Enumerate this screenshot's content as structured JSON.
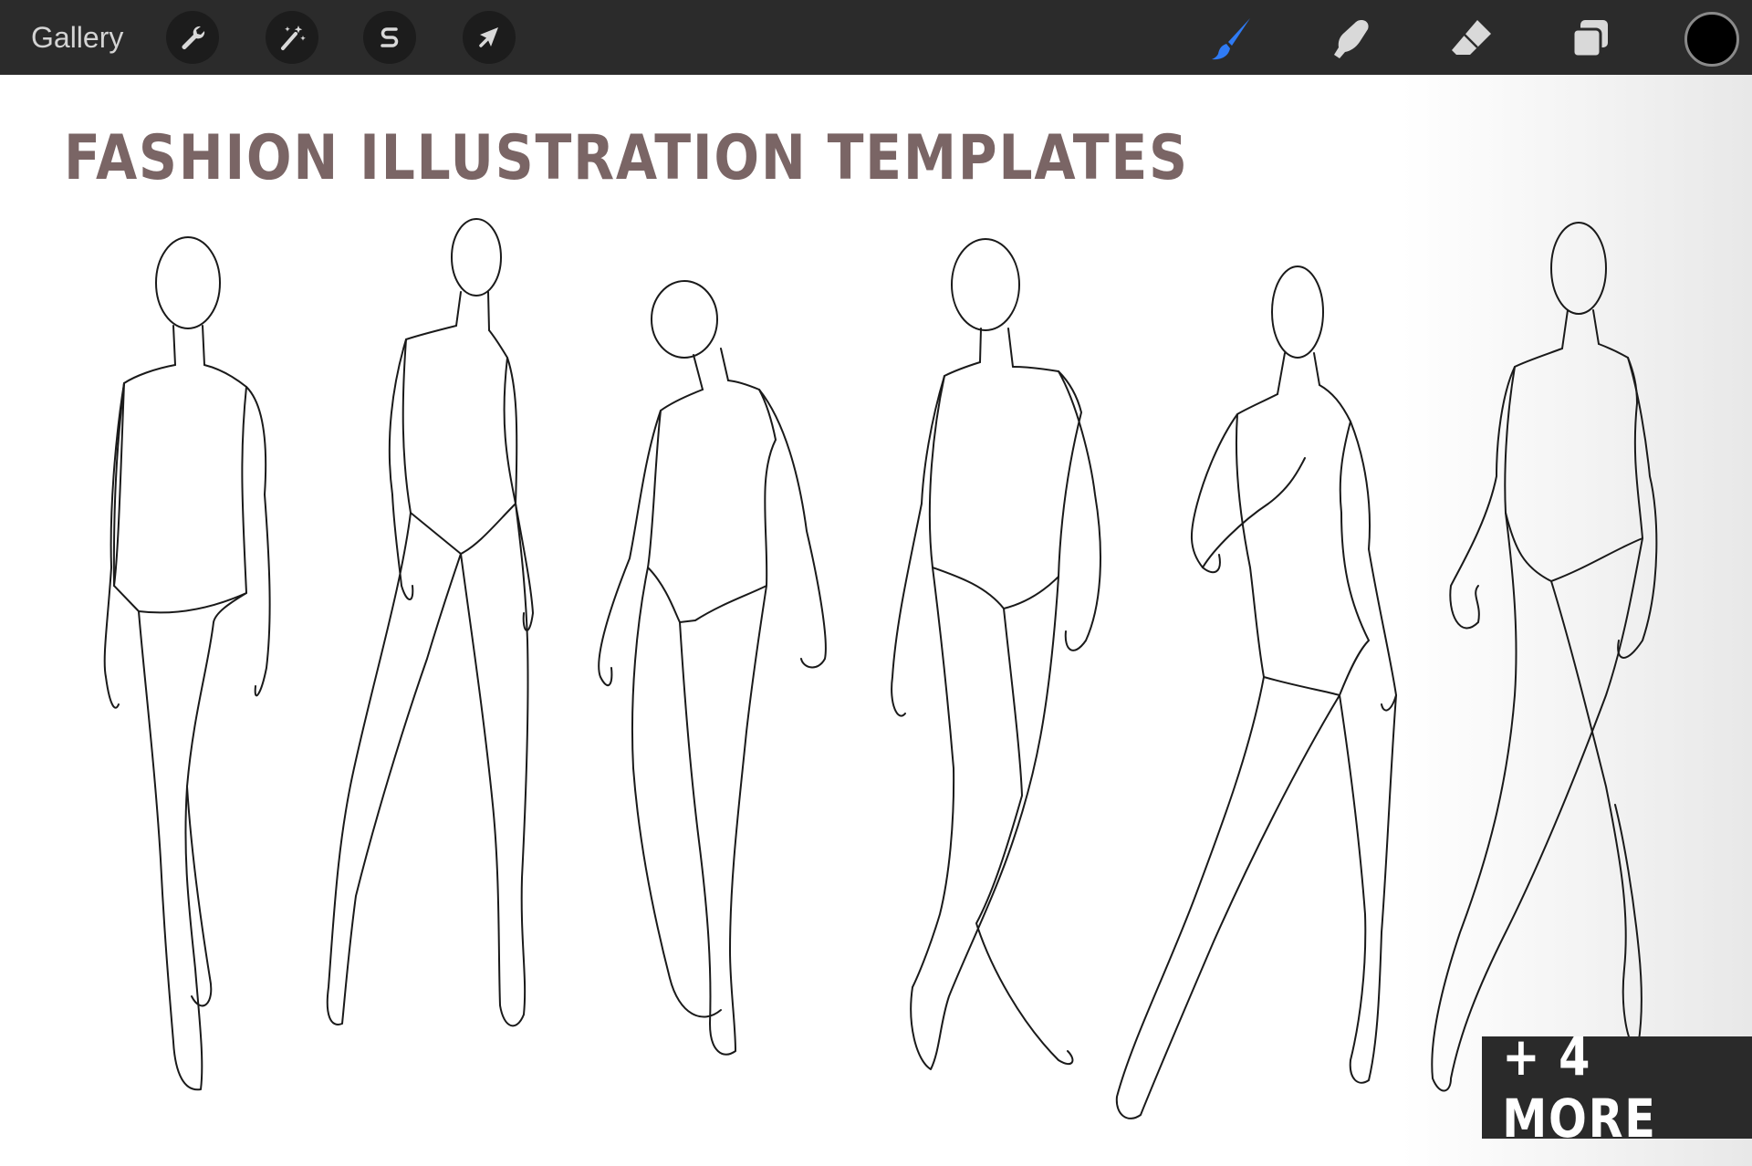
{
  "toolbar": {
    "gallery_label": "Gallery",
    "left_tools": [
      {
        "name": "actions",
        "icon": "wrench-icon"
      },
      {
        "name": "adjustments",
        "icon": "magic-wand-icon"
      },
      {
        "name": "selection",
        "icon": "selection-s-icon"
      },
      {
        "name": "transform",
        "icon": "arrow-cursor-icon"
      }
    ],
    "right_tools": [
      {
        "name": "brush",
        "icon": "brush-icon",
        "active": true,
        "color": "#2f7bf5"
      },
      {
        "name": "smudge",
        "icon": "smudge-finger-icon",
        "active": false,
        "color": "#d9d9d9"
      },
      {
        "name": "eraser",
        "icon": "eraser-icon",
        "active": false,
        "color": "#d9d9d9"
      },
      {
        "name": "layers",
        "icon": "layers-icon",
        "active": false,
        "color": "#d9d9d9"
      }
    ],
    "current_color": "#000000"
  },
  "canvas": {
    "title": "FASHION ILLUSTRATION TEMPLATES",
    "title_color": "#7a6565",
    "figure_count": 6,
    "more_badge": "+ 4 MORE"
  }
}
